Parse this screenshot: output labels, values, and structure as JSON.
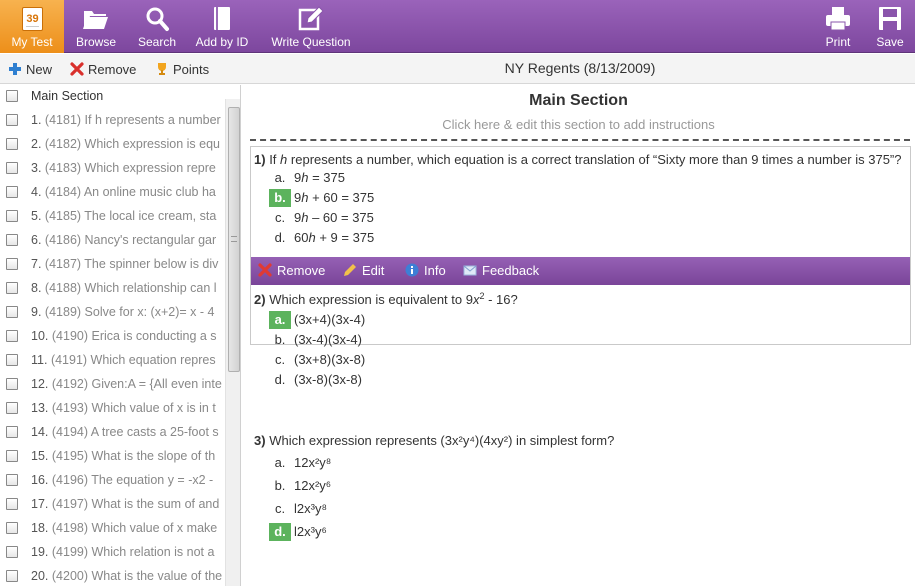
{
  "toolbar": {
    "mytest": {
      "label": "My Test",
      "count": "39"
    },
    "browse": {
      "label": "Browse"
    },
    "search": {
      "label": "Search"
    },
    "add_by_id": {
      "label": "Add by ID"
    },
    "write_question": {
      "label": "Write Question"
    },
    "print": {
      "label": "Print"
    },
    "save": {
      "label": "Save"
    }
  },
  "actions": {
    "new": "New",
    "remove": "Remove",
    "points": "Points"
  },
  "test_title": "NY Regents (8/13/2009)",
  "list": {
    "section": "Main Section",
    "items": [
      {
        "num": "1.",
        "text": "(4181) If h represents a number"
      },
      {
        "num": "2.",
        "text": "(4182) Which expression is equ"
      },
      {
        "num": "3.",
        "text": "(4183) Which expression repre"
      },
      {
        "num": "4.",
        "text": "(4184) An online music club ha"
      },
      {
        "num": "5.",
        "text": "(4185) The local ice cream, sta"
      },
      {
        "num": "6.",
        "text": "(4186) Nancy's rectangular gar"
      },
      {
        "num": "7.",
        "text": "(4187) The spinner below is div"
      },
      {
        "num": "8.",
        "text": "(4188) Which relationship can l"
      },
      {
        "num": "9.",
        "text": "(4189) Solve for x: (x+2)= x - 4"
      },
      {
        "num": "10.",
        "text": "(4190) Erica is conducting a s"
      },
      {
        "num": "11.",
        "text": "(4191) Which equation repres"
      },
      {
        "num": "12.",
        "text": "(4192) Given:A = {All even inte"
      },
      {
        "num": "13.",
        "text": "(4193) Which value of x is in t"
      },
      {
        "num": "14.",
        "text": "(4194) A tree casts a 25-foot s"
      },
      {
        "num": "15.",
        "text": "(4195) What is the slope of th"
      },
      {
        "num": "16.",
        "text": "(4196) The equation y = -x2 -"
      },
      {
        "num": "17.",
        "text": "(4197) What is the sum of and"
      },
      {
        "num": "18.",
        "text": "(4198) Which value of x make"
      },
      {
        "num": "19.",
        "text": "(4199) Which relation is not a"
      },
      {
        "num": "20.",
        "text": "(4200) What is the value of the"
      }
    ]
  },
  "section": {
    "title": "Main Section",
    "instructions": "Click here & edit this section to add instructions"
  },
  "question_actions": {
    "remove": "Remove",
    "edit": "Edit",
    "info": "Info",
    "feedback": "Feedback"
  },
  "questions": [
    {
      "num": "1)",
      "pre": "If",
      "var": "h",
      "post": "represents a number, which equation is a correct translation of “Sixty more than 9 times a number is 375”?",
      "answers": [
        {
          "letter": "a.",
          "coef": "9",
          "var": "h",
          "rest": " = 375",
          "correct": false
        },
        {
          "letter": "b.",
          "coef": "9",
          "var": "h",
          "rest": " + 60 = 375",
          "correct": true
        },
        {
          "letter": "c.",
          "coef": "9",
          "var": "h",
          "rest": " – 60 = 375",
          "correct": false
        },
        {
          "letter": "d.",
          "coef": "60",
          "var": "h",
          "rest": " + 9 = 375",
          "correct": false
        }
      ]
    },
    {
      "num": "2)",
      "pre": "Which expression is equivalent to 9",
      "var": "x",
      "exp": "2",
      "post": " - 16?",
      "answers": [
        {
          "letter": "a.",
          "text": "(3x+4)(3x-4)",
          "correct": true
        },
        {
          "letter": "b.",
          "text": "(3x-4)(3x-4)",
          "correct": false
        },
        {
          "letter": "c.",
          "text": "(3x+8)(3x-8)",
          "correct": false
        },
        {
          "letter": "d.",
          "text": "(3x-8)(3x-8)",
          "correct": false
        }
      ]
    },
    {
      "num": "3)",
      "text": "Which expression represents (3x²y⁴)(4xy²) in simplest form?",
      "answers": [
        {
          "letter": "a.",
          "text": "12x²y⁸",
          "correct": false
        },
        {
          "letter": "b.",
          "text": "12x²y⁶",
          "correct": false
        },
        {
          "letter": "c.",
          "text": "l2x³y⁸",
          "correct": false
        },
        {
          "letter": "d.",
          "text": "l2x³y⁶",
          "correct": true
        }
      ]
    }
  ],
  "colors": {
    "toolbar_purple": "#8a55ab",
    "active_orange": "#f0a030",
    "correct_green": "#5cb35d",
    "remove_red": "#d9302c"
  }
}
